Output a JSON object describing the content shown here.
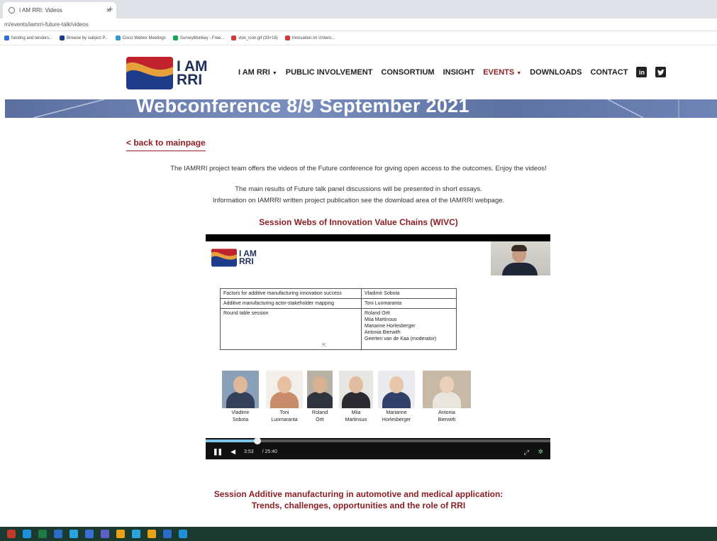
{
  "browser": {
    "tab_title": "I AM RRI: Videos",
    "tab_close": "×",
    "new_tab": "+",
    "url": "rri/events/iamrri-future-talk/videos",
    "bookmarks": [
      {
        "label": "funding and tenders...",
        "color": "#2f6fd6"
      },
      {
        "label": "Browse by subject P...",
        "color": "#1a3d8f"
      },
      {
        "label": "Cisco Webex Meetings",
        "color": "#2c9bd6"
      },
      {
        "label": "SurveyMonkey - Free...",
        "color": "#18a55a"
      },
      {
        "label": "vlox_icon.gif (33×16)",
        "color": "#d23b3b"
      },
      {
        "label": "Innovation im Untern...",
        "color": "#d23b3b"
      }
    ]
  },
  "site": {
    "logo_line1": "I AM",
    "logo_line2": "RRI",
    "nav": [
      {
        "label": "I AM RRI",
        "dropdown": true,
        "active": false
      },
      {
        "label": "PUBLIC INVOLVEMENT",
        "dropdown": false,
        "active": false
      },
      {
        "label": "CONSORTIUM",
        "dropdown": false,
        "active": false
      },
      {
        "label": "INSIGHT",
        "dropdown": false,
        "active": false
      },
      {
        "label": "EVENTS",
        "dropdown": true,
        "active": true
      },
      {
        "label": "DOWNLOADS",
        "dropdown": false,
        "active": false
      },
      {
        "label": "CONTACT",
        "dropdown": false,
        "active": false
      }
    ],
    "social": {
      "linkedin": "in",
      "twitter": "t"
    },
    "banner_title": "Webconference 8/9 September 2021",
    "accent_color": "#8c1e24"
  },
  "content": {
    "back_link": "< back to mainpage",
    "intro": "The IAMRRI project team offers the videos of the Future conference for giving open access to the outcomes. Enjoy the videos!",
    "summary_line1": "The main results of Future talk panel discussions will be presented in short essays.",
    "summary_line2": "Information on IAMRRI written project publication see the download area of the IAMRRI webpage.",
    "session1_title": "Session Webs of Innovation Value Chains (WIVC)",
    "session2_title_line1": "Session Additive manufacturing in automotive and medical application:",
    "session2_title_line2": "Trends, challenges, opportunities and the role of RRI"
  },
  "video": {
    "logo_line1": "I AM",
    "logo_line2": "RRI",
    "agenda": [
      {
        "topic": "Factors for additive manufacturing innovation success",
        "speakers": "Vladimir Sobota"
      },
      {
        "topic": "Additive manufacturing actor-stakeholder mapping",
        "speakers": "Toni Luomaranta"
      },
      {
        "topic": "Round table session",
        "speakers": "Roland Ortt\nMiia Martinsuo\nMarianne Horlesberger\nAntonia Bierwith\nGeerten van de Kaa (moderator)"
      }
    ],
    "people": [
      {
        "name": "Vladimir\nSobota",
        "bg": "#8aa0b8",
        "skin": "#e0b898",
        "cloth": "#34405a"
      },
      {
        "name": "Toni\nLuomaranta",
        "bg": "#f2efea",
        "skin": "#e6c0a0",
        "cloth": "#c98c6a"
      },
      {
        "name": "Roland\nOrtt",
        "bg": "#b8b2a6",
        "skin": "#d9b090",
        "cloth": "#30343f"
      },
      {
        "name": "Miia\nMartinsuo",
        "bg": "#e8e6e2",
        "skin": "#e2bca0",
        "cloth": "#2a2a30"
      },
      {
        "name": "Marianne\nHorlesberger",
        "bg": "#e9ebee",
        "skin": "#e8c6aa",
        "cloth": "#31406b"
      },
      {
        "name": "Antonia\nBierwith",
        "bg": "#c8b9a6",
        "skin": "#ecd0ba",
        "cloth": "#e9e4dc"
      }
    ],
    "current_time": "3:53",
    "duration": "/ 25:40",
    "progress_fraction": 0.151
  },
  "taskbar": {
    "apps": [
      "#c0392b",
      "#1f8fd8",
      "#1e7a40",
      "#2b6cc4",
      "#28a4dd",
      "#3b6fd4",
      "#5b5fc7",
      "#e8a21a",
      "#2aa3e0",
      "#e6a317",
      "#2b6cc4",
      "#1f8fd8"
    ]
  }
}
